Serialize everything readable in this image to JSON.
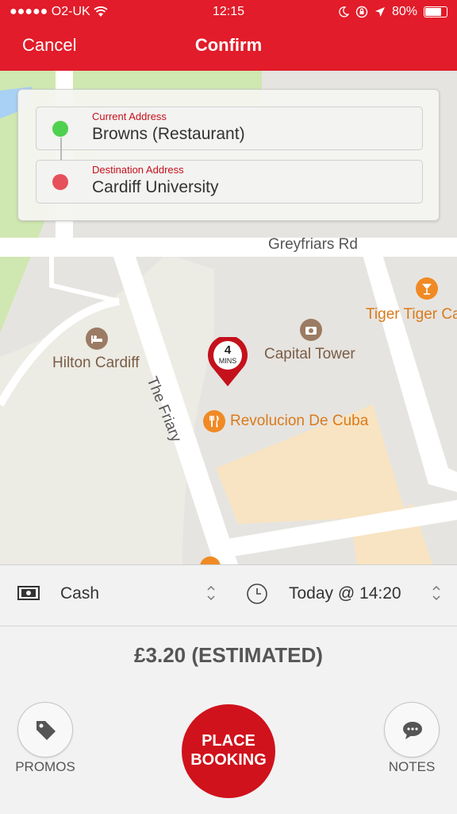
{
  "status_bar": {
    "carrier": "●●●●● O2-UK",
    "time": "12:15",
    "battery": "80%",
    "battery_level": 0.8
  },
  "nav": {
    "cancel_label": "Cancel",
    "title": "Confirm"
  },
  "addresses": {
    "current": {
      "label": "Current Address",
      "value": "Browns (Restaurant)",
      "dot_color": "#4fd14f"
    },
    "destination": {
      "label": "Destination Address",
      "value": "Cardiff University",
      "dot_color": "#e6505a"
    }
  },
  "map": {
    "road_labels": [
      "Greyfriars Rd",
      "The Friary"
    ],
    "places": [
      {
        "name": "Hilton Cardiff",
        "icon": "hotel-icon"
      },
      {
        "name": "Capital Tower",
        "icon": "camera-icon"
      },
      {
        "name": "Revolucion De Cuba",
        "icon": "restaurant-icon"
      },
      {
        "name": "Tiger Tiger Ca",
        "icon": "bar-icon"
      }
    ],
    "eta_pin": {
      "value": "4",
      "unit": "MINS"
    }
  },
  "booking": {
    "payment_method": "Cash",
    "pickup_time": "Today @ 14:20",
    "price": "£3.20 (ESTIMATED)",
    "promos_label": "PROMOS",
    "notes_label": "NOTES",
    "place_booking_line1": "PLACE",
    "place_booking_line2": "BOOKING"
  },
  "colors": {
    "brand_red": "#e21c2a",
    "button_red": "#d0121c",
    "poi_orange": "#f08a24",
    "poi_brown": "#9b7b63"
  }
}
